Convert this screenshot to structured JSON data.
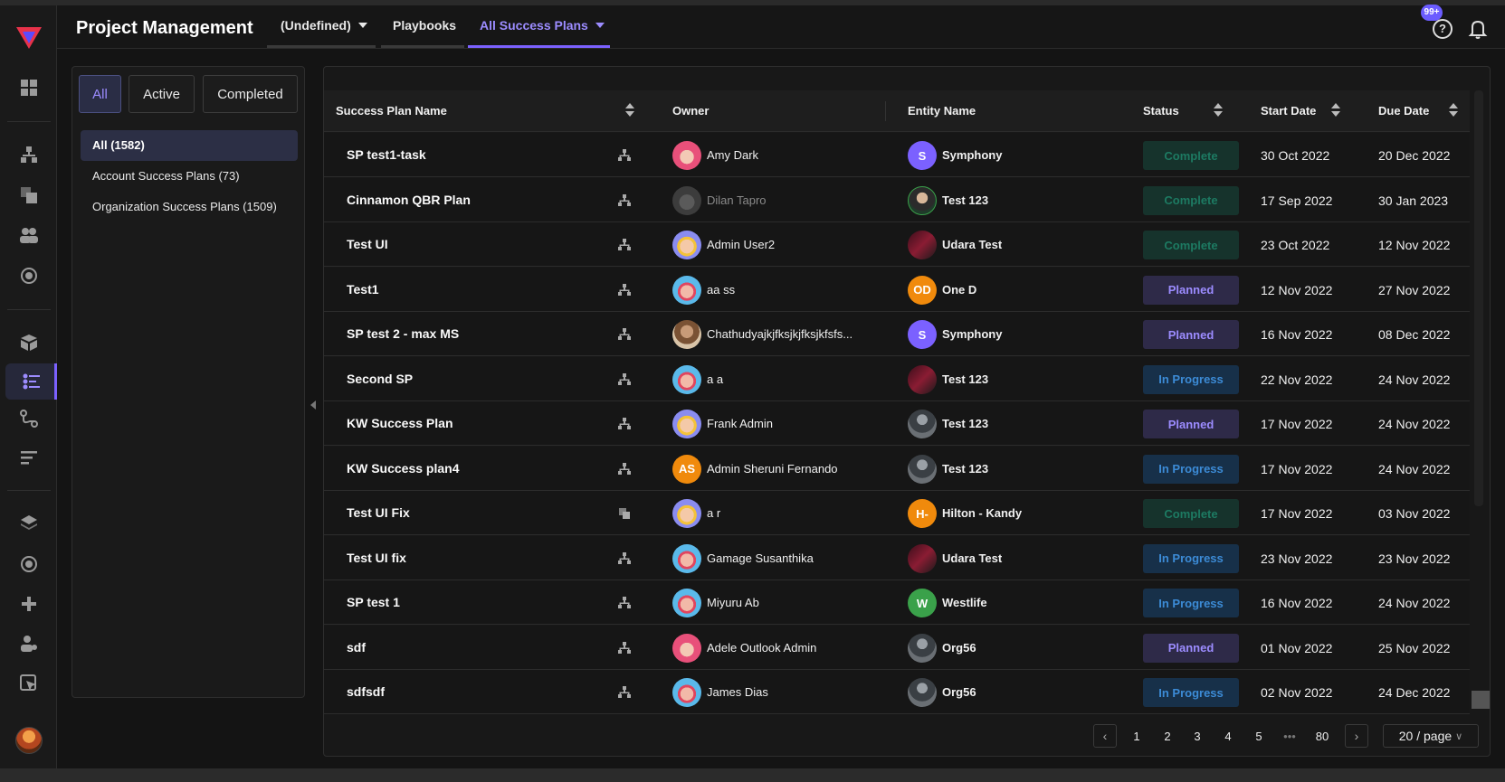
{
  "header": {
    "title": "Project Management",
    "tabs": [
      {
        "label": "(Undefined)",
        "has_caret": true,
        "active": false
      },
      {
        "label": "Playbooks",
        "has_caret": false,
        "active": false
      },
      {
        "label": "All Success Plans",
        "has_caret": true,
        "active": true
      }
    ],
    "help_icon_label": "?",
    "notification_badge": "99+"
  },
  "colors": {
    "accent": "#7b61ff",
    "accent_text": "#9c8cff",
    "complete": "#1d7a62",
    "planned": "#9c8cff",
    "in_progress": "#3c8bd6"
  },
  "sidebar": {
    "icons": [
      "logo-icon",
      "dashboard-icon",
      "hierarchy-icon",
      "layers-icon",
      "users-icon",
      "target-icon",
      "cube-icon",
      "success-plans-icon",
      "workflow-icon",
      "reports-icon",
      "stack-icon",
      "settings-circle-icon",
      "plus-icon",
      "user-settings-icon",
      "pointer-icon"
    ]
  },
  "filters": {
    "segments": [
      {
        "label": "All",
        "active": true
      },
      {
        "label": "Active",
        "active": false
      },
      {
        "label": "Completed",
        "active": false
      }
    ],
    "items": [
      {
        "label": "All (1582)",
        "active": true
      },
      {
        "label": "Account Success Plans (73)",
        "active": false
      },
      {
        "label": "Organization Success Plans (1509)",
        "active": false
      }
    ]
  },
  "table": {
    "columns": {
      "name": "Success Plan Name",
      "owner": "Owner",
      "entity": "Entity Name",
      "status": "Status",
      "start": "Start Date",
      "due": "Due Date"
    },
    "rows": [
      {
        "name": "SP test1-task",
        "icon": "hierarchy-icon",
        "owner": "Amy Dark",
        "owner_avatar": "avatar-pink",
        "entity": "Symphony",
        "entity_initials": "S",
        "entity_avatar": "#7b61ff",
        "status": "Complete",
        "start": "30 Oct 2022",
        "due": "20 Dec 2022"
      },
      {
        "name": "Cinnamon QBR Plan",
        "icon": "hierarchy-icon",
        "owner": "Dilan Tapro",
        "owner_avatar": "avatar-gray",
        "owner_dim": true,
        "entity": "Test 123",
        "entity_initials": "",
        "entity_avatar": "photo",
        "status": "Complete",
        "start": "17 Sep 2022",
        "due": "30 Jan 2023"
      },
      {
        "name": "Test UI",
        "icon": "hierarchy-icon",
        "owner": "Admin User2",
        "owner_avatar": "avatar-yellow",
        "entity": "Udara Test",
        "entity_initials": "",
        "entity_avatar": "dark-red",
        "status": "Complete",
        "start": "23 Oct 2022",
        "due": "12 Nov 2022"
      },
      {
        "name": "Test1",
        "icon": "hierarchy-icon",
        "owner": "aa ss",
        "owner_avatar": "avatar-blue",
        "entity": "One D",
        "entity_initials": "OD",
        "entity_avatar": "#f08a0c",
        "status": "Planned",
        "start": "12 Nov 2022",
        "due": "27 Nov 2022"
      },
      {
        "name": "SP test 2 - max MS",
        "icon": "hierarchy-icon",
        "owner": "Chathudyajkjfksjkjfksjkfsfs...",
        "owner_avatar": "avatar-photo",
        "entity": "Symphony",
        "entity_initials": "S",
        "entity_avatar": "#7b61ff",
        "status": "Planned",
        "start": "16 Nov 2022",
        "due": "08 Dec 2022"
      },
      {
        "name": "Second SP",
        "icon": "hierarchy-icon",
        "owner": "a a",
        "owner_avatar": "avatar-blue",
        "entity": "Test 123",
        "entity_initials": "",
        "entity_avatar": "dark-red",
        "status": "In Progress",
        "start": "22 Nov 2022",
        "due": "24 Nov 2022"
      },
      {
        "name": "KW Success Plan",
        "icon": "hierarchy-icon",
        "owner": "Frank Admin",
        "owner_avatar": "avatar-yellow",
        "entity": "Test 123",
        "entity_initials": "",
        "entity_avatar": "dark-gray",
        "status": "Planned",
        "start": "17 Nov 2022",
        "due": "24 Nov 2022"
      },
      {
        "name": "KW Success plan4",
        "icon": "hierarchy-icon",
        "owner": "Admin Sheruni Fernando",
        "owner_initials": "AS",
        "owner_avatar": "#f08a0c",
        "entity": "Test 123",
        "entity_initials": "",
        "entity_avatar": "dark-gray",
        "status": "In Progress",
        "start": "17 Nov 2022",
        "due": "24 Nov 2022"
      },
      {
        "name": "Test UI Fix",
        "icon": "copy-icon",
        "owner": "a r",
        "owner_avatar": "avatar-yellow",
        "entity": "Hilton - Kandy",
        "entity_initials": "H-",
        "entity_avatar": "#f08a0c",
        "status": "Complete",
        "start": "17 Nov 2022",
        "due": "03 Nov 2022"
      },
      {
        "name": "Test UI fix",
        "icon": "hierarchy-icon",
        "owner": "Gamage Susanthika",
        "owner_avatar": "avatar-blue",
        "entity": "Udara Test",
        "entity_initials": "",
        "entity_avatar": "dark-red",
        "status": "In Progress",
        "start": "23 Nov 2022",
        "due": "23 Nov 2022"
      },
      {
        "name": "SP test 1",
        "icon": "hierarchy-icon",
        "owner": "Miyuru Ab",
        "owner_avatar": "avatar-blue",
        "entity": "Westlife",
        "entity_initials": "W",
        "entity_avatar": "#3aa14a",
        "status": "In Progress",
        "start": "16 Nov 2022",
        "due": "24 Nov 2022"
      },
      {
        "name": "sdf",
        "icon": "hierarchy-icon",
        "owner": "Adele Outlook Admin",
        "owner_avatar": "avatar-pink",
        "entity": "Org56",
        "entity_initials": "",
        "entity_avatar": "dark-gray",
        "status": "Planned",
        "start": "01 Nov 2022",
        "due": "25 Nov 2022"
      },
      {
        "name": "sdfsdf",
        "icon": "hierarchy-icon",
        "owner": "James Dias",
        "owner_avatar": "avatar-blue",
        "entity": "Org56",
        "entity_initials": "",
        "entity_avatar": "dark-gray",
        "status": "In Progress",
        "start": "02 Nov 2022",
        "due": "24 Dec 2022"
      }
    ]
  },
  "pagination": {
    "pages": [
      "1",
      "2",
      "3",
      "4",
      "5"
    ],
    "ellipsis": "•••",
    "last_page": "80",
    "page_size": "20 / page"
  }
}
